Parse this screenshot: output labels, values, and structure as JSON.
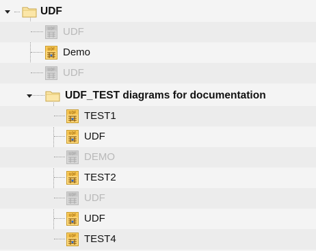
{
  "tree": {
    "root": {
      "label": "UDF",
      "expanded": true,
      "icon": "folder-icon"
    },
    "root_children": [
      {
        "label": "UDF",
        "enabled": false,
        "icon": "udf-diagram-icon"
      },
      {
        "label": "Demo",
        "enabled": true,
        "icon": "udf-diagram-icon"
      },
      {
        "label": "UDF",
        "enabled": false,
        "icon": "udf-diagram-icon"
      }
    ],
    "subfolder": {
      "label": "UDF_TEST diagrams for documentation",
      "expanded": true,
      "icon": "folder-icon"
    },
    "subfolder_children": [
      {
        "label": "TEST1",
        "enabled": true,
        "icon": "udf-diagram-icon"
      },
      {
        "label": "UDF",
        "enabled": true,
        "icon": "udf-diagram-icon"
      },
      {
        "label": "DEMO",
        "enabled": false,
        "icon": "udf-diagram-icon"
      },
      {
        "label": "TEST2",
        "enabled": true,
        "icon": "udf-diagram-icon"
      },
      {
        "label": "UDF",
        "enabled": false,
        "icon": "udf-diagram-icon"
      },
      {
        "label": "UDF",
        "enabled": true,
        "icon": "udf-diagram-icon"
      },
      {
        "label": "TEST4",
        "enabled": true,
        "icon": "udf-diagram-icon"
      }
    ],
    "icon_badge_text": "UDF"
  }
}
